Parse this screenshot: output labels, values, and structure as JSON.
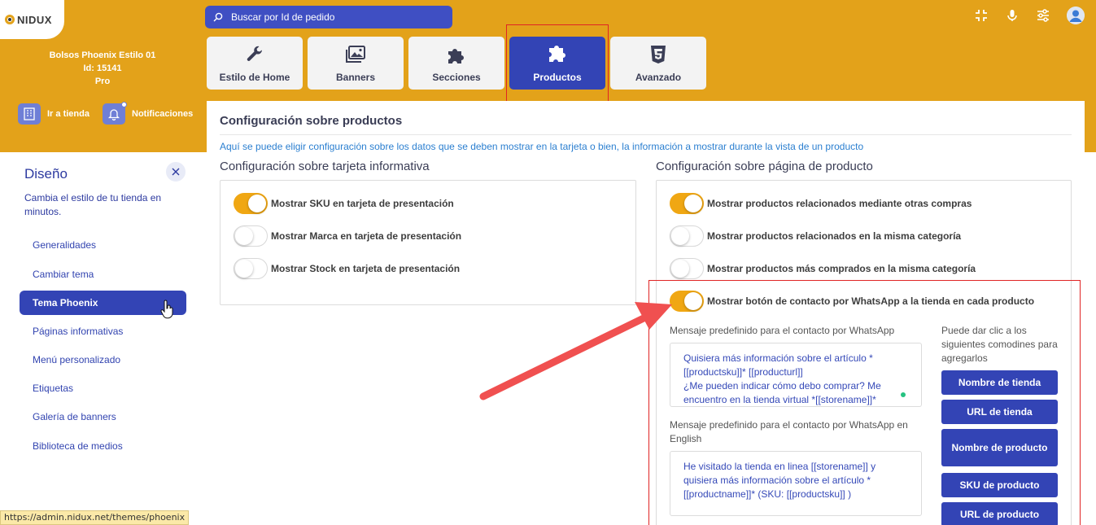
{
  "brand": {
    "logo_text": "NIDUX"
  },
  "search": {
    "placeholder": "Buscar por Id de pedido"
  },
  "store": {
    "name": "Bolsos Phoenix Estilo 01",
    "id_text": "Id: 15141",
    "plan": "Pro"
  },
  "quick_actions": {
    "store_link": "Ir a tienda",
    "notifications": "Notificaciones"
  },
  "tabs": [
    {
      "label": "Estilo de Home",
      "icon": "wrench-icon",
      "active": false
    },
    {
      "label": "Banners",
      "icon": "images-icon",
      "active": false
    },
    {
      "label": "Secciones",
      "icon": "puzzle-icon",
      "active": false
    },
    {
      "label": "Productos",
      "icon": "puzzle-icon",
      "active": true
    },
    {
      "label": "Avanzado",
      "icon": "css3-icon",
      "active": false
    }
  ],
  "sidebar": {
    "title": "Diseño",
    "description": "Cambia el estilo de tu tienda en minutos.",
    "items": [
      {
        "label": "Generalidades",
        "active": false
      },
      {
        "label": "Cambiar tema",
        "active": false
      },
      {
        "label": "Tema Phoenix",
        "active": true
      },
      {
        "label": "Páginas informativas",
        "active": false
      },
      {
        "label": "Menú personalizado",
        "active": false
      },
      {
        "label": "Etiquetas",
        "active": false
      },
      {
        "label": "Galería de banners",
        "active": false
      },
      {
        "label": "Biblioteca de medios",
        "active": false
      }
    ]
  },
  "status_url": "https://admin.nidux.net/themes/phoenix",
  "content": {
    "title": "Configuración sobre productos",
    "description": "Aquí se puede eligir configuración sobre los datos que se deben mostrar en la tarjeta o bien, la información a mostrar durante la vista de un producto",
    "card_section": {
      "title": "Configuración sobre tarjeta informativa",
      "toggles": [
        {
          "label": "Mostrar SKU en tarjeta de presentación",
          "on": true
        },
        {
          "label": "Mostrar Marca en tarjeta de presentación",
          "on": false
        },
        {
          "label": "Mostrar Stock en tarjeta de presentación",
          "on": false
        }
      ]
    },
    "product_section": {
      "title": "Configuración sobre página de producto",
      "toggles": [
        {
          "label": "Mostrar productos relacionados mediante otras compras",
          "on": true
        },
        {
          "label": "Mostrar productos relacionados en la misma categoría",
          "on": false
        },
        {
          "label": "Mostrar productos más comprados en la misma categoría",
          "on": false
        },
        {
          "label": "Mostrar botón de contacto por WhatsApp a la tienda en cada producto",
          "on": true
        }
      ],
      "whatsapp": {
        "msg_label": "Mensaje predefinido para el contacto por WhatsApp",
        "msg_value": "Quisiera más información sobre el artículo *[[productsku]]* [[producturl]]\n¿Me pueden indicar cómo debo comprar? Me encuentro en la tienda virtual *[[storename]]*",
        "msg_en_label": "Mensaje predefinido para el contacto por WhatsApp en English",
        "msg_en_value": "He visitado la tienda en linea [[storename]] y quisiera más información sobre el artículo *[[productname]]* (SKU: [[productsku]] )",
        "wildcards_help": "Puede dar clic a los siguientes comodines para agregarlos",
        "wildcards": [
          "Nombre de tienda",
          "URL de tienda",
          "Nombre de producto",
          "SKU de producto",
          "URL de producto"
        ]
      }
    }
  },
  "colors": {
    "header": "#e3a21a",
    "primary": "#3344b5",
    "toggle_on": "#f0a713",
    "highlight": "#e02424"
  }
}
